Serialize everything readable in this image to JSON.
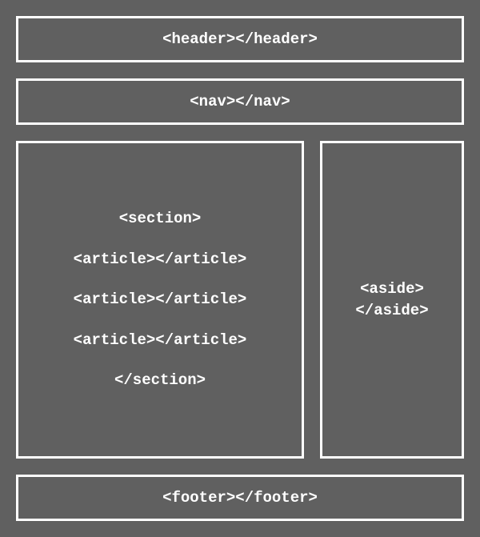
{
  "header": {
    "label": "<header></header>"
  },
  "nav": {
    "label": "<nav></nav>"
  },
  "section": {
    "open": "<section>",
    "articles": [
      "<article></article>",
      "<article></article>",
      "<article></article>"
    ],
    "close": "</section>"
  },
  "aside": {
    "open": "<aside>",
    "close": "</aside>"
  },
  "footer": {
    "label": "<footer></footer>"
  }
}
